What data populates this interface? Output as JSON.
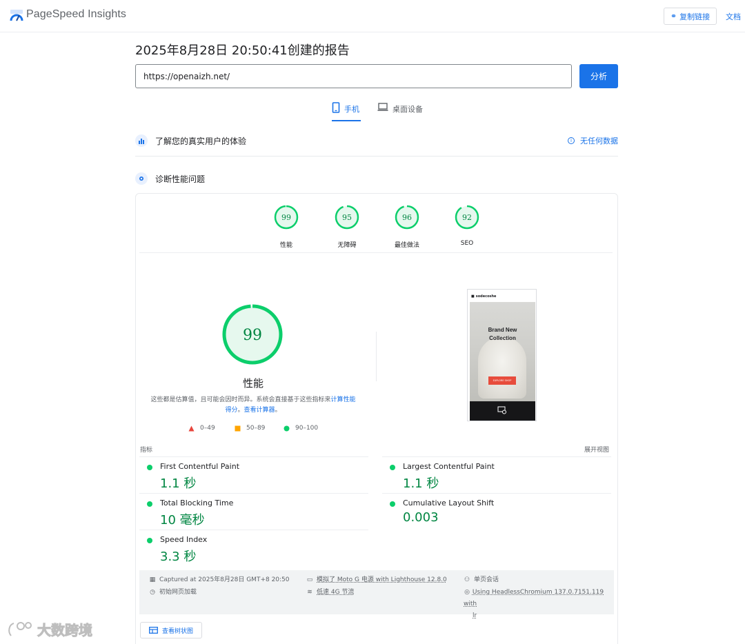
{
  "header": {
    "brand": "PageSpeed Insights",
    "copy_link": "复制链接",
    "docs": "文档"
  },
  "report": {
    "title": "2025年8月28日 20:50:41创建的报告",
    "url": "https://openaizh.net/",
    "analyze": "分析"
  },
  "tabs": [
    {
      "label": "手机",
      "selected": true
    },
    {
      "label": "桌面设备",
      "selected": false
    }
  ],
  "real_users": {
    "title": "了解您的真实用户的体验",
    "no_data": "无任何数据"
  },
  "diagnose": {
    "title": "诊断性能问题"
  },
  "scores": [
    {
      "value": "99",
      "label": "性能"
    },
    {
      "value": "95",
      "label": "无障碍"
    },
    {
      "value": "96",
      "label": "最佳做法"
    },
    {
      "value": "92",
      "label": "SEO"
    }
  ],
  "performance": {
    "score": "99",
    "title": "性能",
    "note_text": "这些都是估算值，且可能会因时而异。系统会直接基于这些指标来",
    "note_link1": "计算性能得分",
    "note_sep": "。",
    "note_link2": "查看计算器",
    "note_end": "。"
  },
  "legend": [
    {
      "range": "0–49",
      "shape": "triangle",
      "color": "#e8453c"
    },
    {
      "range": "50–89",
      "shape": "square",
      "color": "#ffa400"
    },
    {
      "range": "90–100",
      "shape": "circle",
      "color": "#0cce6b"
    }
  ],
  "screenshot": {
    "site_name": "sodecoshe",
    "hero_title_1": "Brand New",
    "hero_title_2": "Collection",
    "button": "EXPLORE SHOP"
  },
  "metrics": {
    "heading": "指标",
    "expand": "展开视图",
    "items": [
      {
        "name": "First Contentful Paint",
        "value": "1.1 秒"
      },
      {
        "name": "Largest Contentful Paint",
        "value": "1.1 秒"
      },
      {
        "name": "Total Blocking Time",
        "value": "10 毫秒"
      },
      {
        "name": "Cumulative Layout Shift",
        "value": "0.003"
      },
      {
        "name": "Speed Index",
        "value": "3.3 秒"
      }
    ]
  },
  "info": {
    "captured": "Captured at 2025年8月28日 GMT+8 20:50",
    "initial_load": "初始网页加载",
    "device": "模拟了 Moto G 电源 with Lighthouse 12.8.0",
    "throttle": "低速 4G 节流",
    "session": "单页会话",
    "browser_1": "Using HeadlessChromium 137.0.7151.119 with",
    "browser_2": "lr"
  },
  "treemap": "查看树状图",
  "watermark": "大数跨境",
  "colors": {
    "accent": "#1a73e8",
    "pass": "#0cce6b",
    "pass_text": "#018642"
  }
}
